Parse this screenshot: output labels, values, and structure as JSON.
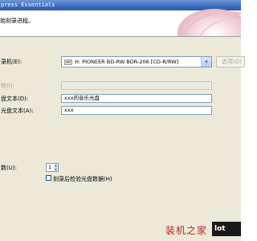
{
  "window": {
    "title": "press Essentials"
  },
  "header": {
    "subtitle": "始刻录进程。"
  },
  "recorder": {
    "label": "录机(E):",
    "selected": "H: PIONEER BD-RW   BDR-206  [CD-R/RW]",
    "options_button": "选项(O)"
  },
  "fields": {
    "disabled_label": "称(I):",
    "disc_text_label": "盘文本(D):",
    "disc_text_value": "xxx的音乐光盘",
    "artist_text_label": "光盘文本(A):",
    "artist_text_value": "xxx"
  },
  "copies": {
    "label": "数(U):",
    "value": "1"
  },
  "verify": {
    "label": "刻录后检验光盘数据(H)",
    "checked": false
  },
  "watermark": {
    "text": "装机之家",
    "url": "lot"
  }
}
